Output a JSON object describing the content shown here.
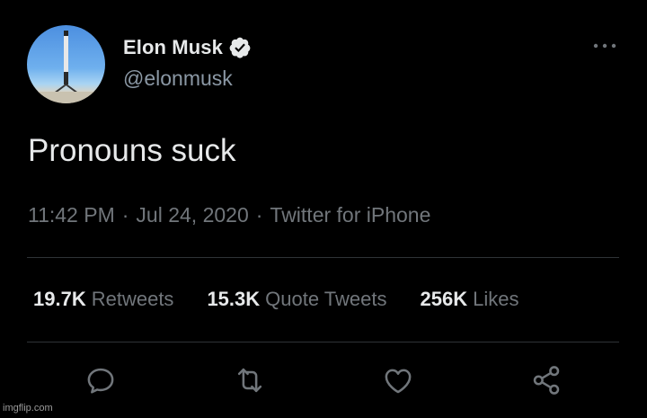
{
  "author": {
    "name": "Elon Musk",
    "handle": "@elonmusk",
    "verified": true,
    "avatar_icon": "rocket-booster-avatar"
  },
  "tweet": {
    "text": "Pronouns suck",
    "time": "11:42 PM",
    "date": "Jul 24, 2020",
    "source": "Twitter for iPhone",
    "separator": "·"
  },
  "stats": [
    {
      "count": "19.7K",
      "label": "Retweets"
    },
    {
      "count": "15.3K",
      "label": "Quote Tweets"
    },
    {
      "count": "256K",
      "label": "Likes"
    }
  ],
  "actions": [
    {
      "icon": "reply-icon"
    },
    {
      "icon": "retweet-icon"
    },
    {
      "icon": "like-icon"
    },
    {
      "icon": "share-icon"
    }
  ],
  "menu_icon": "more-options-icon",
  "watermark": "imgflip.com",
  "colors": {
    "background": "#000000",
    "primary_text": "#e7e9ea",
    "secondary_text": "#71767b",
    "divider": "#2f3336"
  }
}
